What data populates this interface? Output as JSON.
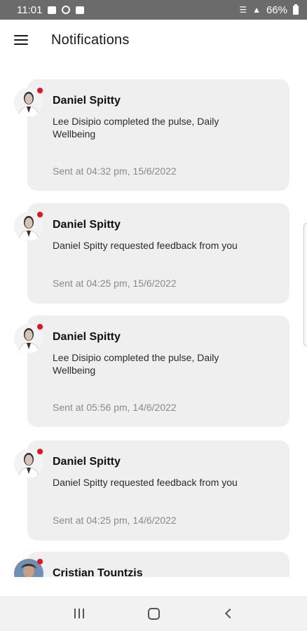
{
  "status_bar": {
    "time": "11:01",
    "battery": "66%"
  },
  "header": {
    "title": "Notifications",
    "menu_icon": "hamburger-menu-icon"
  },
  "notifications": [
    {
      "sender": "Daniel Spitty",
      "message": "Lee Disipio completed the pulse, Daily Wellbeing",
      "timestamp": "Sent at 04:32 pm, 15/6/2022",
      "unread": true
    },
    {
      "sender": "Daniel Spitty",
      "message": "Daniel Spitty requested feedback from you",
      "timestamp": "Sent at 04:25 pm, 15/6/2022",
      "unread": true
    },
    {
      "sender": "Daniel Spitty",
      "message": "Lee Disipio completed the pulse, Daily Wellbeing",
      "timestamp": "Sent at 05:56 pm, 14/6/2022",
      "unread": true
    },
    {
      "sender": "Daniel Spitty",
      "message": "Daniel Spitty requested feedback from you",
      "timestamp": "Sent at 04:25 pm, 14/6/2022",
      "unread": true
    },
    {
      "sender": "Cristian Tountzis",
      "message": "",
      "timestamp": "",
      "unread": true
    }
  ],
  "colors": {
    "unread_dot": "#e8101b",
    "card_background": "#efefef"
  },
  "nav_bar": {
    "recents_icon": "recents-icon",
    "home_icon": "home-icon",
    "back_icon": "back-icon"
  }
}
